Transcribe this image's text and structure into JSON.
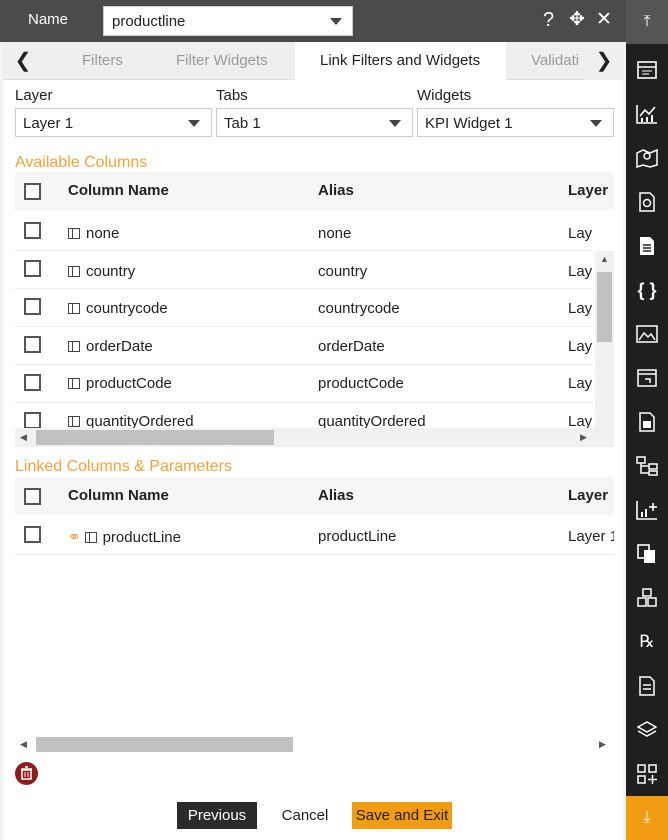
{
  "header": {
    "name_label": "Name",
    "name_value": "productline"
  },
  "tabs": [
    "Filters",
    "Filter Widgets",
    "Link Filters and Widgets",
    "Validati"
  ],
  "selectors": {
    "layer_label": "Layer",
    "layer_value": "Layer 1",
    "tabs_label": "Tabs",
    "tabs_value": "Tab 1",
    "widgets_label": "Widgets",
    "widgets_value": "KPI Widget 1"
  },
  "available": {
    "title": "Available Columns",
    "headers": [
      "Column Name",
      "Alias",
      "Layer"
    ],
    "rows": [
      {
        "name": "none",
        "alias": "none",
        "layer": "Lay"
      },
      {
        "name": "country",
        "alias": "country",
        "layer": "Lay"
      },
      {
        "name": "countrycode",
        "alias": "countrycode",
        "layer": "Lay"
      },
      {
        "name": "orderDate",
        "alias": "orderDate",
        "layer": "Lay"
      },
      {
        "name": "productCode",
        "alias": "productCode",
        "layer": "Lay"
      },
      {
        "name": "quantityOrdered",
        "alias": "quantityOrdered",
        "layer": "Lay"
      }
    ]
  },
  "linked": {
    "title": "Linked Columns & Parameters",
    "headers": [
      "Column Name",
      "Alias",
      "Layer"
    ],
    "rows": [
      {
        "name": "productLine",
        "alias": "productLine",
        "layer": "Layer 1"
      }
    ]
  },
  "buttons": {
    "previous": "Previous",
    "cancel": "Cancel",
    "save": "Save and Exit"
  },
  "colors": {
    "accent": "#f3a33c",
    "header": "#4a4a4a",
    "sidebar": "#1f1f1f",
    "sidebar_bottom": "#f39c12"
  }
}
